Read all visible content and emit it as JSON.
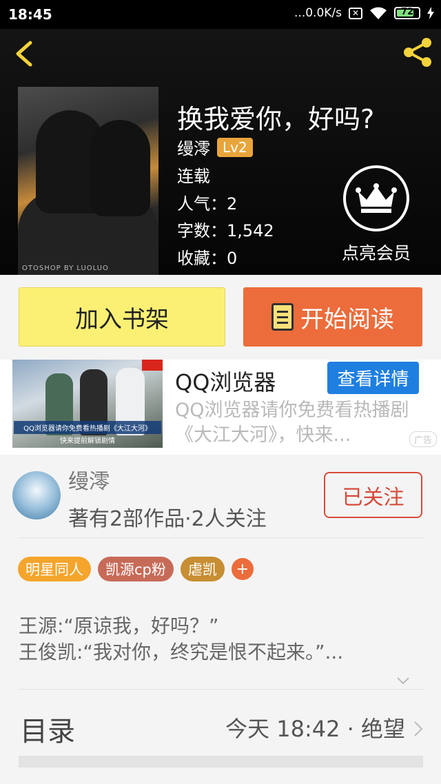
{
  "status_bar": {
    "time": "18:45",
    "speed": "...0.0K/s",
    "battery": "72"
  },
  "book": {
    "title": "换我爱你，好吗?",
    "author": "缦澪",
    "level": "Lv2",
    "status": "连载",
    "popularity": "人气：2",
    "word_count": "字数：1,542",
    "favorites": "收藏：0",
    "cover_watermark": "OTOSHOP BY LUOLUO"
  },
  "vip": {
    "label": "点亮会员"
  },
  "actions": {
    "add_to_shelf": "加入书架",
    "start_reading": "开始阅读"
  },
  "ad": {
    "title": "QQ浏览器",
    "button": "查看详情",
    "description": "QQ浏览器请你免费看热播剧《大江大河》，快来...",
    "mark": "广告",
    "image_caption": "QQ浏览器请你免费看热播剧《大江大河》",
    "image_caption2": "快来提前解锁剧情"
  },
  "author_card": {
    "name": "缦澪",
    "stats": "著有2部作品·2人关注",
    "follow_label": "已关注",
    "tags": [
      {
        "label": "明星同人",
        "color": "#f5a52c"
      },
      {
        "label": "凯源cp粉",
        "color": "#c76b58"
      },
      {
        "label": "虐凯",
        "color": "#c78e33"
      }
    ],
    "intro_line1": "王源:“原谅我，好吗？”",
    "intro_line2": "王俊凯:“我对你，终究是恨不起来。”..."
  },
  "toc": {
    "label": "目录",
    "latest": "今天 18:42 · 绝望"
  },
  "colors": {
    "accent_orange": "#ec6c3b",
    "shelf_yellow": "#fbf074",
    "ad_blue": "#1f7fe0",
    "follow_red": "#d64a3a",
    "icon_yellow": "#f5d33b"
  }
}
